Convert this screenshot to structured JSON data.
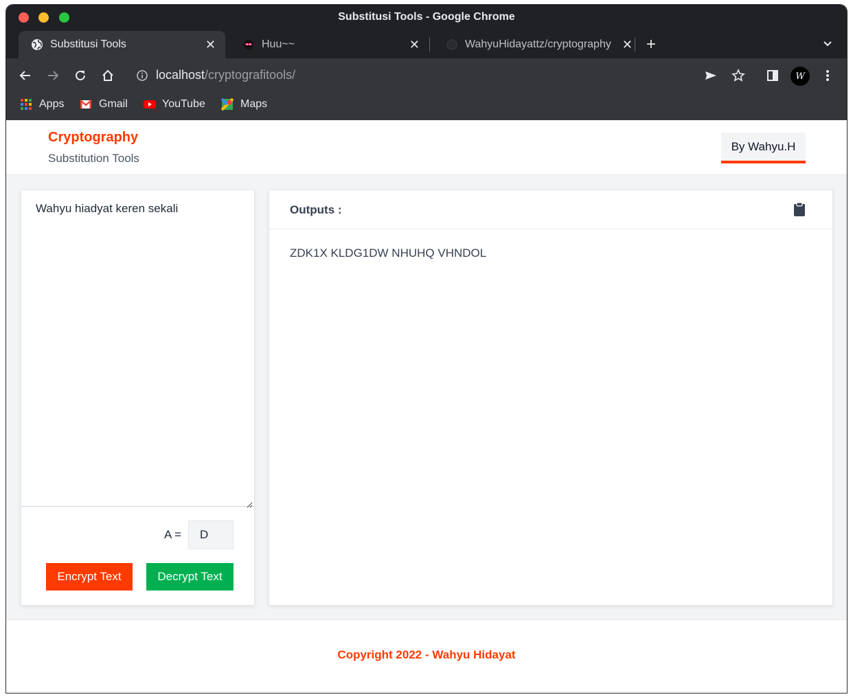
{
  "window": {
    "title": "Substitusi Tools - Google Chrome"
  },
  "tabs": [
    {
      "label": "Substitusi Tools",
      "active": true
    },
    {
      "label": "Huu~~",
      "active": false
    },
    {
      "label": "WahyuHidayattz/cryptography",
      "active": false
    }
  ],
  "toolbar": {
    "url_host": "localhost",
    "url_path": "/cryptografitools/",
    "profile_initial": "W"
  },
  "bookmarks": [
    {
      "label": "Apps",
      "icon": "apps-grid-icon"
    },
    {
      "label": "Gmail",
      "icon": "gmail-icon"
    },
    {
      "label": "YouTube",
      "icon": "youtube-icon"
    },
    {
      "label": "Maps",
      "icon": "maps-icon"
    }
  ],
  "header": {
    "brand": "Cryptography",
    "subtitle": "Substitution Tools",
    "author_button": "By Wahyu.H",
    "accent": "#ff3a00"
  },
  "input": {
    "text": "Wahyu hiadyat keren sekali",
    "key_label": "A =",
    "key_value": "D",
    "encrypt_label": "Encrypt Text",
    "decrypt_label": "Decrypt Text",
    "encrypt_color": "#ff3a00",
    "decrypt_color": "#00b050"
  },
  "output": {
    "title": "Outputs :",
    "text": "ZDK1X KLDG1DW NHUHQ VHNDOL"
  },
  "footer": {
    "copyright": "Copyright 2022 - Wahyu Hidayat"
  }
}
